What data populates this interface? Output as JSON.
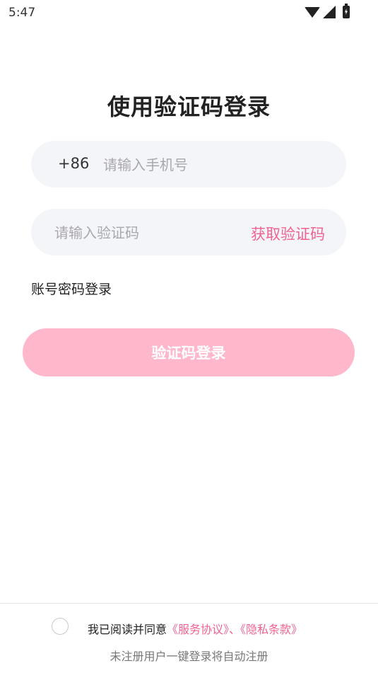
{
  "status_bar": {
    "time": "5:47"
  },
  "title": "使用验证码登录",
  "phone": {
    "prefix": "+86",
    "placeholder": "请输入手机号"
  },
  "code": {
    "placeholder": "请输入验证码",
    "get_code_label": "获取验证码"
  },
  "account_login_link": "账号密码登录",
  "login_button": "验证码登录",
  "agreement": {
    "prefix": "我已阅读并同意",
    "service_link": "《服务协议》",
    "separator": "、",
    "privacy_link": "《隐私条款》"
  },
  "footnote": "未注册用户一键登录将自动注册",
  "colors": {
    "accent": "#f2628f",
    "button_disabled": "#ffb7cb",
    "field_bg": "#f4f5f9"
  }
}
